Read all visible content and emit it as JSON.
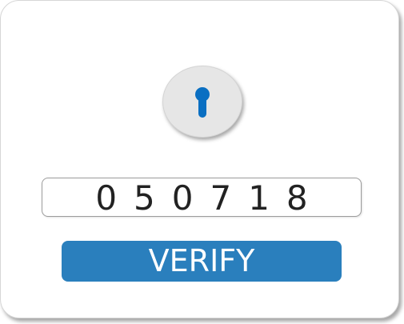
{
  "lock": {
    "icon": "keyhole-icon",
    "color": "#0a6fc2",
    "background": "#e6e6e6"
  },
  "code": {
    "value": "050718"
  },
  "verify": {
    "label": "VERIFY",
    "color": "#2a7fbd"
  }
}
